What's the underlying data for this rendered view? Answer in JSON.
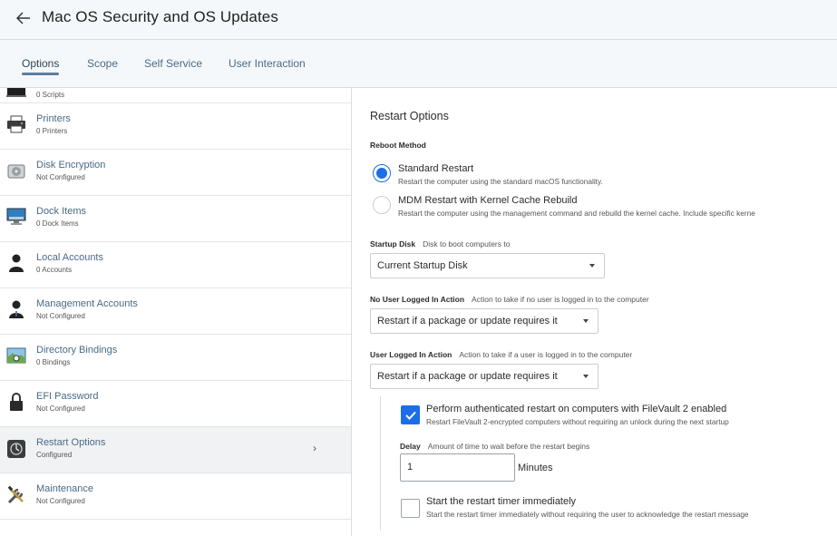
{
  "header": {
    "title": "Mac OS Security and OS Updates",
    "back_icon": "arrow-left-icon"
  },
  "tabs": [
    {
      "label": "Options",
      "active": true
    },
    {
      "label": "Scope",
      "active": false
    },
    {
      "label": "Self Service",
      "active": false
    },
    {
      "label": "User Interaction",
      "active": false
    }
  ],
  "sidebar": {
    "items": [
      {
        "label": "",
        "sub": "0 Scripts",
        "icon": "scripts-icon"
      },
      {
        "label": "Printers",
        "sub": "0 Printers",
        "icon": "printer-icon"
      },
      {
        "label": "Disk Encryption",
        "sub": "Not Configured",
        "icon": "disk-encryption-icon"
      },
      {
        "label": "Dock Items",
        "sub": "0 Dock Items",
        "icon": "dock-icon"
      },
      {
        "label": "Local Accounts",
        "sub": "0 Accounts",
        "icon": "local-account-icon"
      },
      {
        "label": "Management Accounts",
        "sub": "Not Configured",
        "icon": "management-account-icon"
      },
      {
        "label": "Directory Bindings",
        "sub": "0 Bindings",
        "icon": "directory-icon"
      },
      {
        "label": "EFI Password",
        "sub": "Not Configured",
        "icon": "lock-icon"
      },
      {
        "label": "Restart Options",
        "sub": "Configured",
        "icon": "restart-icon",
        "selected": true,
        "chevron": "›"
      },
      {
        "label": "Maintenance",
        "sub": "Not Configured",
        "icon": "tools-icon"
      }
    ]
  },
  "main": {
    "section_title": "Restart Options",
    "reboot_method": {
      "label": "Reboot Method",
      "options": [
        {
          "title": "Standard Restart",
          "desc": "Restart the computer using the standard macOS functionality.",
          "selected": true
        },
        {
          "title": "MDM Restart with Kernel Cache Rebuild",
          "desc": "Restart the computer using the management command and rebuild the kernel cache. Include specific kerne",
          "selected": false
        }
      ]
    },
    "startup_disk": {
      "label": "Startup Disk",
      "hint": "Disk to boot computers to",
      "value": "Current Startup Disk"
    },
    "no_user": {
      "label": "No User Logged In Action",
      "hint": "Action to take if no user is logged in to the computer",
      "value": "Restart if a package or update requires it"
    },
    "user_logged": {
      "label": "User Logged In Action",
      "hint": "Action to take if a user is logged in to the computer",
      "value": "Restart if a package or update requires it"
    },
    "filevault": {
      "title": "Perform authenticated restart on computers with FileVault 2 enabled",
      "desc": "Restart FileVault 2-encrypted computers without requiring an unlock during the next startup",
      "checked": true
    },
    "delay": {
      "label": "Delay",
      "hint": "Amount of time to wait before the restart begins",
      "value": "1",
      "unit": "Minutes"
    },
    "timer": {
      "title": "Start the restart timer immediately",
      "desc": "Start the restart timer immediately without requiring the user to acknowledge the restart message",
      "checked": false
    }
  },
  "colors": {
    "accent": "#1c6ee8",
    "link": "#4a6a86",
    "header_bg": "#f5f8fa"
  }
}
